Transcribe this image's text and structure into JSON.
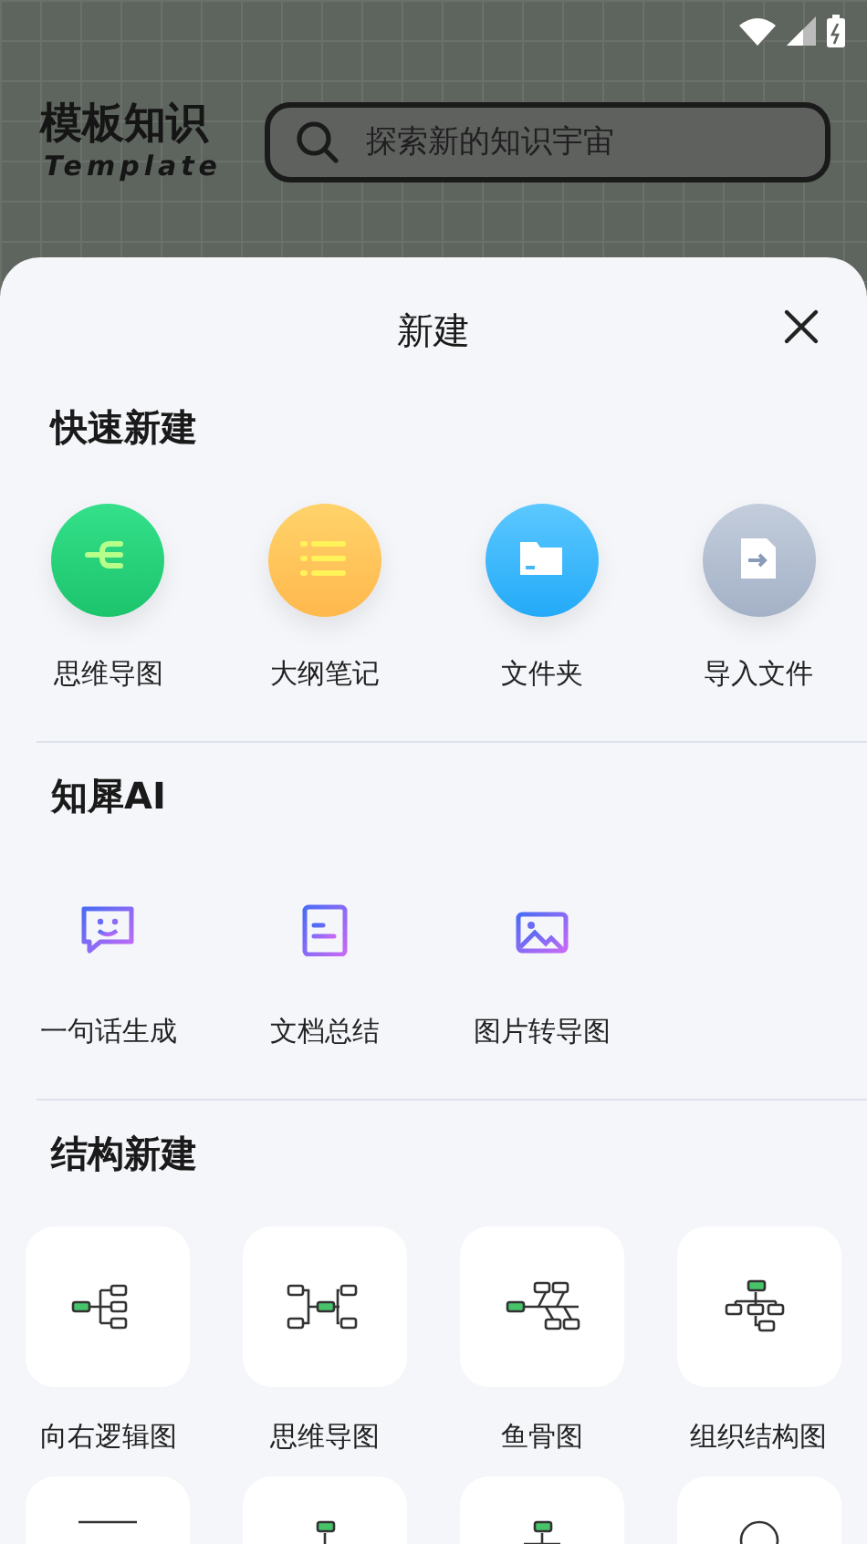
{
  "header": {
    "title": "模板知识",
    "subtitle": "Template",
    "search": {
      "placeholder": "探索新的知识宇宙"
    }
  },
  "sheet": {
    "title": "新建",
    "quick": {
      "heading": "快速新建",
      "items": [
        {
          "kind": "mindmap",
          "label": "思维导图"
        },
        {
          "kind": "outline",
          "label": "大纲笔记"
        },
        {
          "kind": "folder",
          "label": "文件夹"
        },
        {
          "kind": "import",
          "label": "导入文件"
        }
      ]
    },
    "ai": {
      "heading": "知犀AI",
      "items": [
        {
          "kind": "chat",
          "label": "一句话生成"
        },
        {
          "kind": "document",
          "label": "文档总结"
        },
        {
          "kind": "image",
          "label": "图片转导图"
        }
      ]
    },
    "structure": {
      "heading": "结构新建",
      "items": [
        {
          "kind": "logic-right",
          "label": "向右逻辑图"
        },
        {
          "kind": "mindmap",
          "label": "思维导图"
        },
        {
          "kind": "fishbone",
          "label": "鱼骨图"
        },
        {
          "kind": "org",
          "label": "组织结构图"
        },
        {
          "kind": "timeline"
        },
        {
          "kind": "tree-down"
        },
        {
          "kind": "org-down"
        },
        {
          "kind": "circle"
        }
      ]
    }
  }
}
